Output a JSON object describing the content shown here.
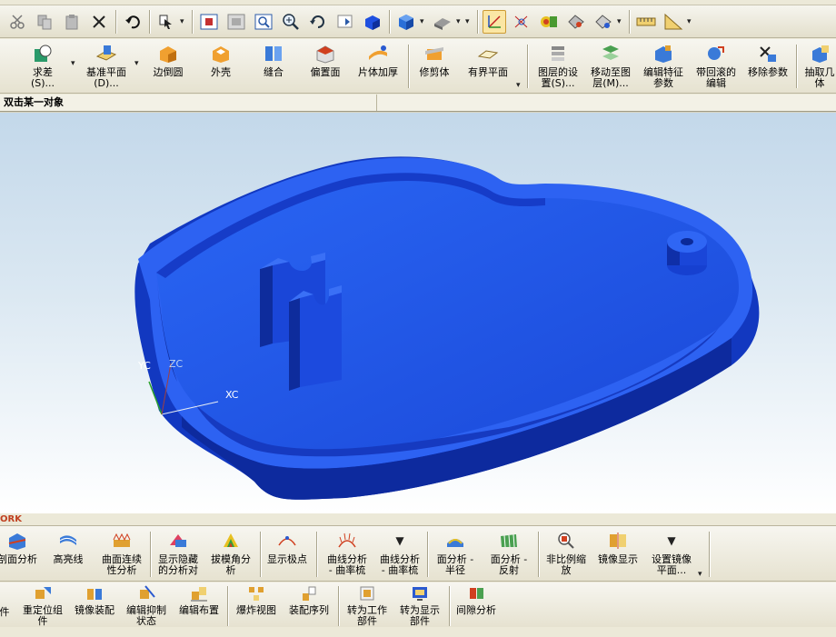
{
  "toolbar_standard": {
    "items": [
      "cut",
      "copy",
      "paste",
      "delete",
      "undo",
      "select-filter",
      "fit",
      "zoom-window",
      "zoom-in",
      "zoom",
      "rotate",
      "pan",
      "render-style",
      "view-orientation",
      "shaded",
      "wcs",
      "snap-point",
      "analysis",
      "clip",
      "measure",
      "ruler"
    ]
  },
  "toolbar_features": {
    "items": [
      {
        "label": "求差",
        "sub": "(S)..."
      },
      {
        "label": "基准平面",
        "sub": "(D)..."
      },
      {
        "label": "边倒圆",
        "sub": ""
      },
      {
        "label": "外壳",
        "sub": ""
      },
      {
        "label": "缝合",
        "sub": ""
      },
      {
        "label": "偏置面",
        "sub": ""
      },
      {
        "label": "片体加厚",
        "sub": ""
      },
      {
        "label": "修剪体",
        "sub": ""
      },
      {
        "label": "有界平面",
        "sub": ""
      },
      {
        "label": "图层的设",
        "sub": "置(S)..."
      },
      {
        "label": "移动至图",
        "sub": "层(M)..."
      },
      {
        "label": "编辑特征",
        "sub": "参数"
      },
      {
        "label": "带回滚的",
        "sub": "编辑"
      },
      {
        "label": "移除参数",
        "sub": ""
      },
      {
        "label": "抽取几",
        "sub": "体"
      }
    ]
  },
  "prompt": {
    "text": "双击某一对象"
  },
  "viewport": {
    "wcs_x": "XC",
    "wcs_y": "YC",
    "wcs_z": "ZC",
    "part_color": "#1f50e0"
  },
  "status": {
    "text": "ORK"
  },
  "toolbar_analysis": {
    "items": [
      {
        "label": "剖面分析",
        "sub": ""
      },
      {
        "label": "高亮线",
        "sub": ""
      },
      {
        "label": "曲面连续",
        "sub": "性分析"
      },
      {
        "label": "显示隐藏",
        "sub": "的分析对"
      },
      {
        "label": "拔模角分",
        "sub": "析"
      },
      {
        "label": "显示极点",
        "sub": ""
      },
      {
        "label": "曲线分析",
        "sub": "- 曲率梳"
      },
      {
        "label": "曲线分析",
        "sub": "- 曲率梳"
      },
      {
        "label": "面分析 -",
        "sub": "半径"
      },
      {
        "label": "面分析 -",
        "sub": "反射"
      },
      {
        "label": "非比例缩",
        "sub": "放"
      },
      {
        "label": "镜像显示",
        "sub": ""
      },
      {
        "label": "设置镜像",
        "sub": "平面..."
      }
    ]
  },
  "toolbar_assembly": {
    "items": [
      {
        "label": "件"
      },
      {
        "label": "重定位组",
        "sub": "件"
      },
      {
        "label": "镜像装配"
      },
      {
        "label": "编辑抑制",
        "sub": "状态"
      },
      {
        "label": "编辑布置"
      },
      {
        "label": "爆炸视图"
      },
      {
        "label": "装配序列"
      },
      {
        "label": "转为工作",
        "sub": "部件"
      },
      {
        "label": "转为显示",
        "sub": "部件"
      },
      {
        "label": "间隙分析"
      }
    ]
  }
}
